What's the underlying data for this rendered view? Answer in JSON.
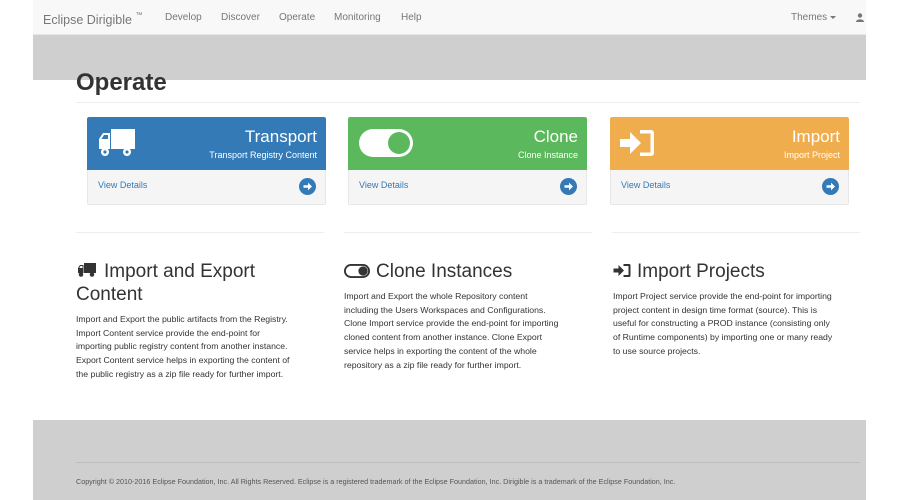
{
  "navbar": {
    "brand": "Eclipse Dirigible",
    "brand_mark": "™",
    "items": [
      {
        "label": "Develop"
      },
      {
        "label": "Discover"
      },
      {
        "label": "Operate"
      },
      {
        "label": "Monitoring"
      },
      {
        "label": "Help"
      }
    ],
    "themes_label": "Themes",
    "user_icon": "user-icon"
  },
  "page": {
    "title": "Operate"
  },
  "panels": [
    {
      "title": "Transport",
      "subtitle": "Transport Registry Content",
      "link": "View Details",
      "icon": "truck-icon",
      "color": "#337ab7"
    },
    {
      "title": "Clone",
      "subtitle": "Clone Instance",
      "link": "View Details",
      "icon": "toggle-icon",
      "color": "#5cb85c"
    },
    {
      "title": "Import",
      "subtitle": "Import Project",
      "link": "View Details",
      "icon": "sign-in-icon",
      "color": "#f0ad4e"
    }
  ],
  "panel_link_color": "#337ab7",
  "sections": [
    {
      "title_line1": "Import and Export",
      "title_line2": "Content",
      "icon": "truck-icon",
      "body": [
        "Import and Export the public artifacts from the Registry.",
        "Import Content service provide the end-point for",
        "importing public registry content from another instance.",
        "Export Content service helps in exporting the content of",
        "the public registry as a zip file ready for further import."
      ]
    },
    {
      "title": "Clone Instances",
      "icon": "toggle-icon",
      "body": [
        "Import and Export the whole Repository content",
        "including the Users Workspaces and Configurations.",
        "Clone Import service provide the end-point for importing",
        "cloned content from another instance. Clone Export",
        "service helps in exporting the content of the whole",
        "repository as a zip file ready for further import."
      ]
    },
    {
      "title": "Import Projects",
      "icon": "sign-in-icon",
      "body": [
        "Import Project service provide the end-point for importing",
        "project content in design time format (source). This is",
        "useful for constructing a PROD instance (consisting only",
        "of Runtime components) by importing one or many ready",
        "to use source projects."
      ]
    }
  ],
  "footer": {
    "text": "Copyright © 2010-2016 Eclipse Foundation, Inc. All Rights Reserved. Eclipse is a registered trademark of the Eclipse Foundation, Inc. Dirigible is a trademark of the Eclipse Foundation, Inc."
  }
}
